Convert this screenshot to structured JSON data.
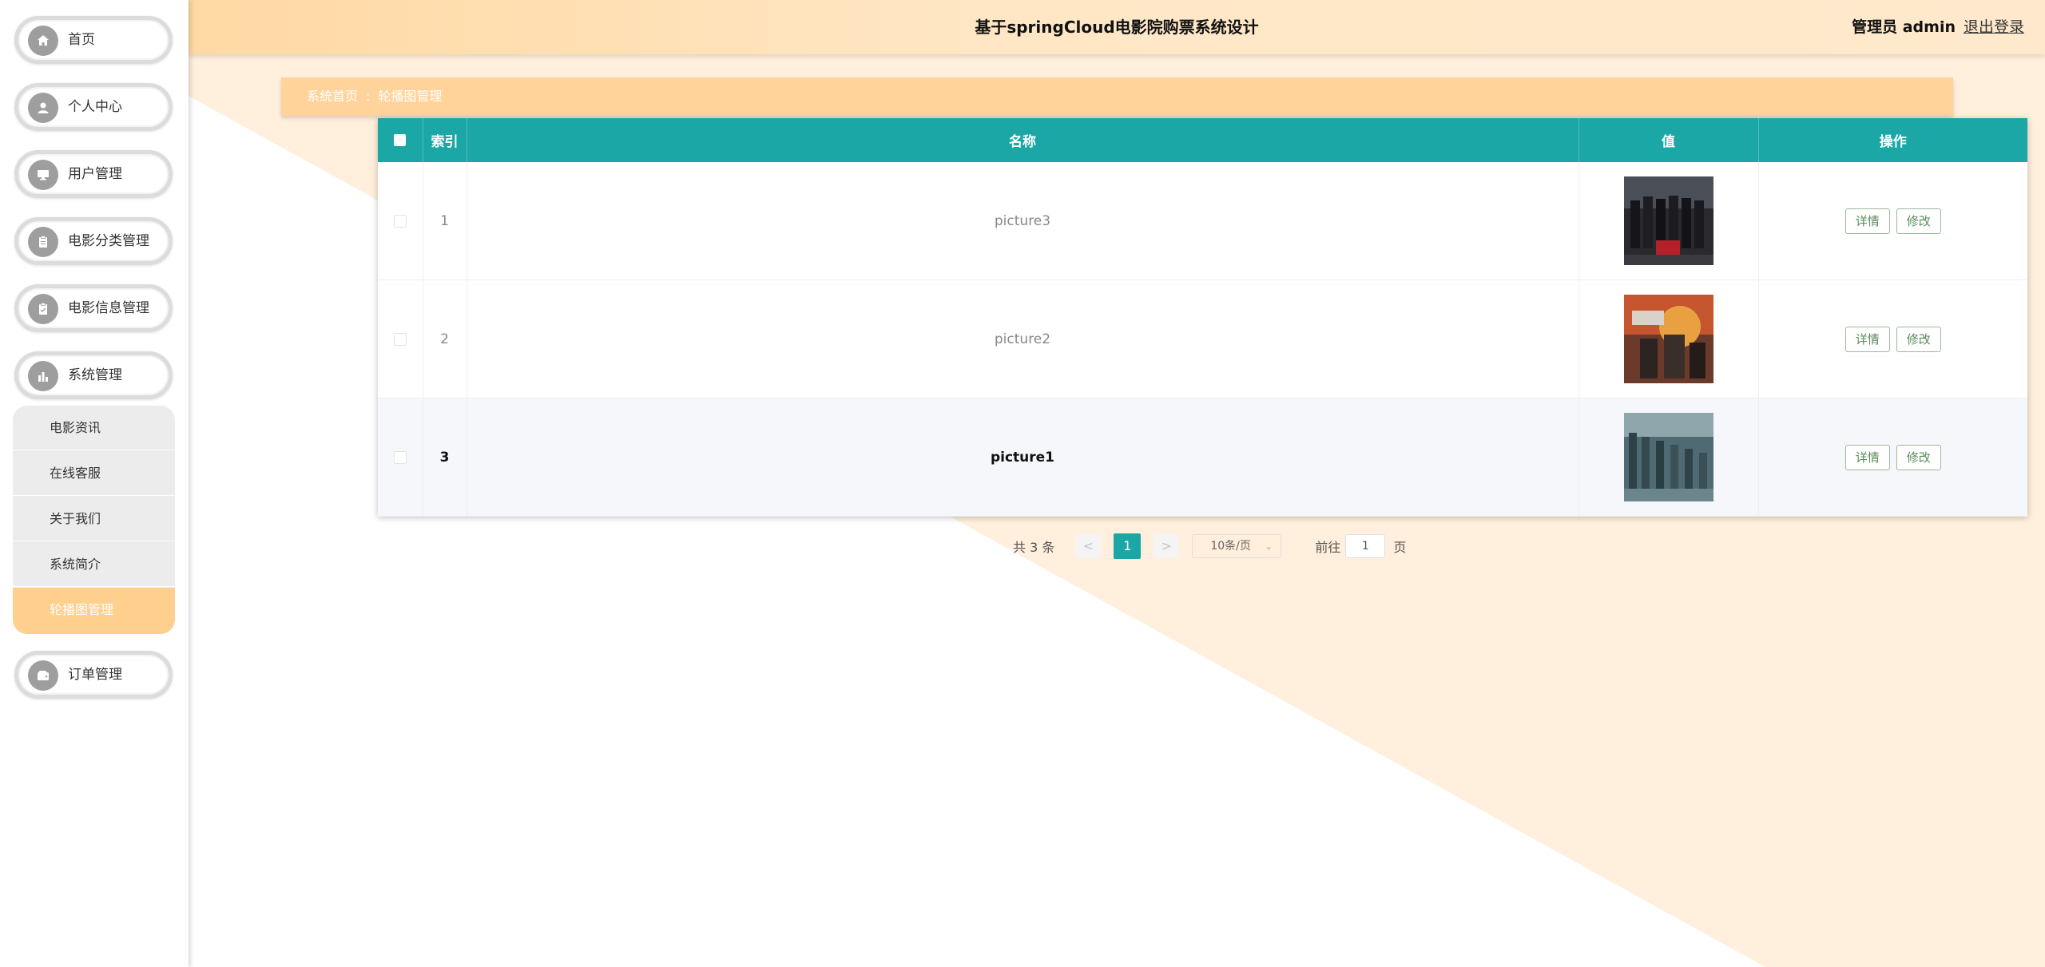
{
  "header": {
    "title": "基于springCloud电影院购票系统设计",
    "admin_label": "管理员 admin",
    "logout_label": "退出登录"
  },
  "sidebar": {
    "items": [
      {
        "label": "首页",
        "icon": "home-icon"
      },
      {
        "label": "个人中心",
        "icon": "user-icon"
      },
      {
        "label": "用户管理",
        "icon": "monitor-icon"
      },
      {
        "label": "电影分类管理",
        "icon": "clipboard-icon"
      },
      {
        "label": "电影信息管理",
        "icon": "clipboard-check-icon"
      },
      {
        "label": "系统管理",
        "icon": "bar-chart-icon"
      },
      {
        "label": "订单管理",
        "icon": "wallet-icon"
      }
    ],
    "submenu": [
      {
        "label": "电影资讯"
      },
      {
        "label": "在线客服"
      },
      {
        "label": "关于我们"
      },
      {
        "label": "系统简介"
      },
      {
        "label": "轮播图管理",
        "active": true
      }
    ]
  },
  "breadcrumb": {
    "home": "系统首页",
    "separator": ":",
    "current": "轮播图管理"
  },
  "table": {
    "columns": [
      "索引",
      "名称",
      "值",
      "操作"
    ],
    "rows": [
      {
        "index": "1",
        "name": "picture3",
        "detail": "详情",
        "edit": "修改"
      },
      {
        "index": "2",
        "name": "picture2",
        "detail": "详情",
        "edit": "修改"
      },
      {
        "index": "3",
        "name": "picture1",
        "detail": "详情",
        "edit": "修改"
      }
    ]
  },
  "pagination": {
    "total": "共 3 条",
    "prev": "<",
    "current_page": "1",
    "next": ">",
    "page_size": "10条/页",
    "goto_label": "前往",
    "goto_value": "1",
    "page_suffix": "页"
  },
  "colors": {
    "accent": "#1ba7a6",
    "header_bg": "#ffe2b8",
    "breadcrumb_bg": "#ffd39a",
    "active_menu": "#ffcf8e"
  }
}
